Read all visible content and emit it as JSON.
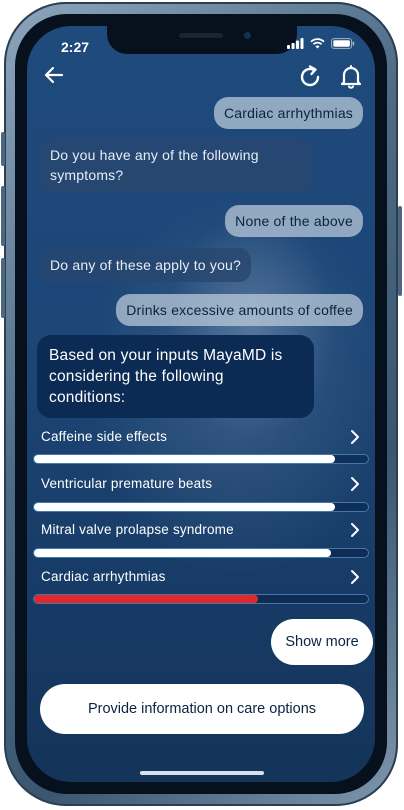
{
  "status_bar": {
    "time": "2:27"
  },
  "header": {
    "back_icon": "arrow-left-icon",
    "refresh_icon": "refresh-icon",
    "bell_icon": "bell-icon"
  },
  "chat": {
    "user_1": "Cardiac arrhythmias",
    "bot_1": "Do you have any of the following symptoms?",
    "user_2": "None of the above",
    "bot_2": "Do any of these apply to you?",
    "user_3": "Drinks excessive amounts of coffee",
    "bot_3": "Based on your inputs MayaMD is considering the following conditions:"
  },
  "conditions": [
    {
      "label": "Caffeine side effects",
      "likelihood": 0.9,
      "color": "#ffffff"
    },
    {
      "label": "Ventricular premature beats",
      "likelihood": 0.9,
      "color": "#ffffff"
    },
    {
      "label": "Mitral valve prolapse syndrome",
      "likelihood": 0.89,
      "color": "#ffffff"
    },
    {
      "label": "Cardiac arrhythmias",
      "likelihood": 0.67,
      "color": "#e3282d"
    }
  ],
  "actions": {
    "show_more": "Show more",
    "care_options": "Provide information on care options"
  },
  "colors": {
    "accent_bar_border": "#3e7ab0",
    "bot_bubble": "#0b2b55",
    "alert_red": "#e3282d"
  }
}
